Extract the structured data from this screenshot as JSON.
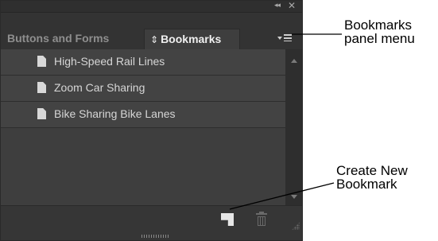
{
  "panel": {
    "collapse_glyph": "◂◂",
    "close_glyph": "✕",
    "tabs": [
      {
        "label": "Buttons and Forms",
        "active": false
      },
      {
        "label": "Bookmarks",
        "active": true,
        "prefix": "⇕"
      }
    ],
    "bookmarks": [
      {
        "label": "High-Speed Rail Lines"
      },
      {
        "label": "Zoom Car Sharing"
      },
      {
        "label": "Bike Sharing Bike Lanes"
      }
    ]
  },
  "callouts": {
    "panel_menu": [
      "Bookmarks",
      "panel menu"
    ],
    "create_new": [
      "Create New",
      "Bookmark"
    ]
  },
  "colors": {
    "panel_bg": "#3c3c3c",
    "row_bg": "#434343",
    "text": "#d6d6d6",
    "inactive_tab_text": "#8e8e8e"
  }
}
